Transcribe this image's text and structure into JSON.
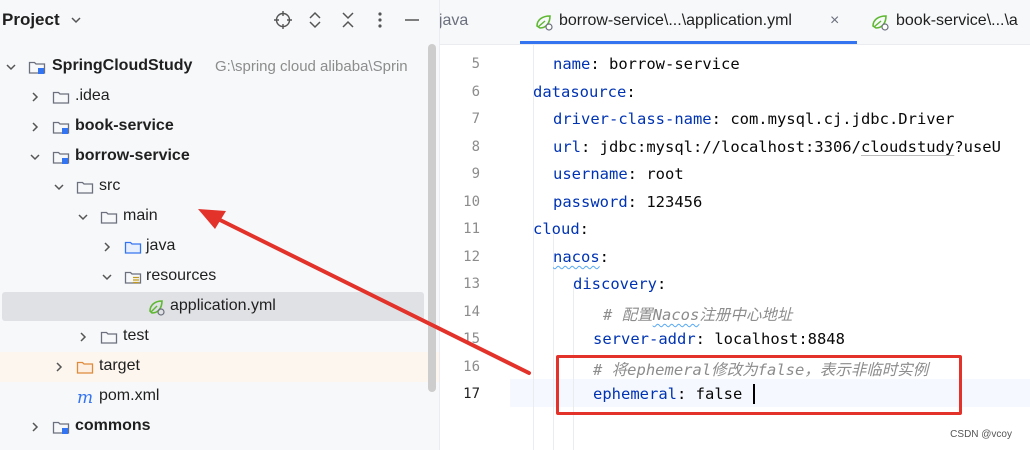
{
  "project_panel": {
    "title": "Project",
    "tree": [
      {
        "label": "SpringCloudStudy",
        "path": "G:\\spring cloud alibaba\\Sprin",
        "kind": "module",
        "bold": true,
        "expanded": true
      },
      {
        "label": ".idea",
        "kind": "folder",
        "bold": false,
        "expanded": false
      },
      {
        "label": "book-service",
        "kind": "module",
        "bold": true,
        "expanded": false
      },
      {
        "label": "borrow-service",
        "kind": "module",
        "bold": true,
        "expanded": true
      },
      {
        "label": "src",
        "kind": "folder",
        "bold": false,
        "expanded": true
      },
      {
        "label": "main",
        "kind": "folder",
        "bold": false,
        "expanded": true
      },
      {
        "label": "java",
        "kind": "source-folder",
        "bold": false,
        "expanded": false
      },
      {
        "label": "resources",
        "kind": "resources-folder",
        "bold": false,
        "expanded": true
      },
      {
        "label": "application.yml",
        "kind": "yaml-file",
        "bold": false,
        "selected": true
      },
      {
        "label": "test",
        "kind": "folder",
        "bold": false,
        "expanded": false
      },
      {
        "label": "target",
        "kind": "excluded-folder",
        "bold": false,
        "expanded": false
      },
      {
        "label": "pom.xml",
        "kind": "maven-file",
        "bold": false
      },
      {
        "label": "commons",
        "kind": "module",
        "bold": true,
        "expanded": false
      }
    ]
  },
  "tabs": [
    {
      "label": "t.java",
      "active": false
    },
    {
      "label": "borrow-service\\...\\application.yml",
      "active": true,
      "close": "×"
    },
    {
      "label": "book-service\\...\\a",
      "active": false
    }
  ],
  "editor": {
    "line_numbers": [
      "5",
      "6",
      "7",
      "8",
      "9",
      "10",
      "11",
      "12",
      "13",
      "14",
      "15",
      "16",
      "17"
    ],
    "lines": {
      "l5": {
        "key": "name",
        "sep": ": ",
        "val": "borrow-service"
      },
      "l6": {
        "key": "datasource",
        "sep": ":"
      },
      "l7": {
        "key": "driver-class-name",
        "sep": ": ",
        "val": "com.mysql.cj.jdbc.Driver"
      },
      "l8": {
        "key": "url",
        "sep": ": ",
        "val_a": "jdbc:mysql://localhost:3306/",
        "val_b": "cloudstudy",
        "val_c": "?useU"
      },
      "l9": {
        "key": "username",
        "sep": ": ",
        "val": "root"
      },
      "l10": {
        "key": "password",
        "sep": ": ",
        "val": "123456"
      },
      "l11": {
        "key": "cloud",
        "sep": ":"
      },
      "l12": {
        "key": "nacos",
        "sep": ":"
      },
      "l13": {
        "key": "discovery",
        "sep": ":"
      },
      "l14": {
        "hash": "# ",
        "c1": "配置",
        "c2": "Nacos",
        "c3": "注册中心地址"
      },
      "l15": {
        "key": "server-addr",
        "sep": ": ",
        "val": "localhost:8848"
      },
      "l16": {
        "comment": "# 将ephemeral修改为false，表示非临时实例"
      },
      "l17": {
        "key": "ephemeral",
        "sep": ": ",
        "val": "false"
      }
    }
  },
  "watermark": "CSDN @vcoy",
  "colors": {
    "highlight_box": "#e2322a",
    "annotation_arrow": "#e2322a",
    "active_tab_underline": "#3574f0"
  }
}
